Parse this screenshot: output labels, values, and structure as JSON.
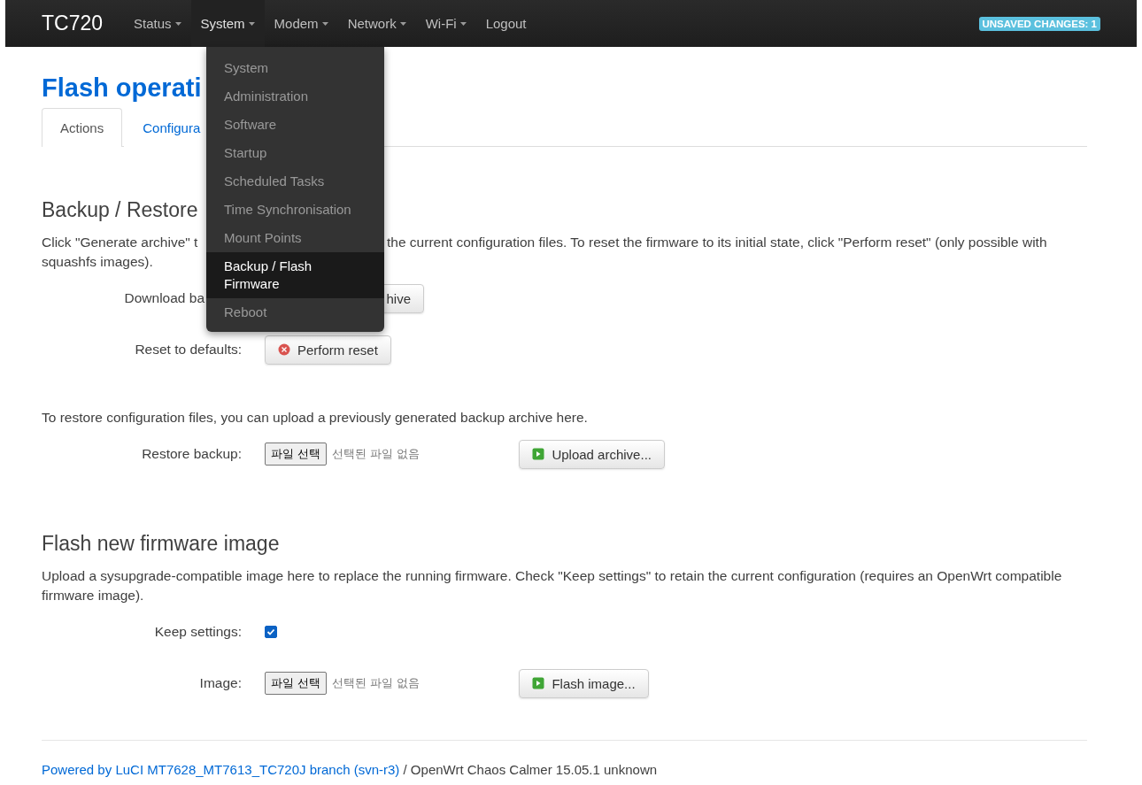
{
  "navbar": {
    "brand": "TC720",
    "items": [
      {
        "label": "Status",
        "caret": true,
        "selected": false
      },
      {
        "label": "System",
        "caret": true,
        "selected": true
      },
      {
        "label": "Modem",
        "caret": true,
        "selected": false
      },
      {
        "label": "Network",
        "caret": true,
        "selected": false
      },
      {
        "label": "Wi-Fi",
        "caret": true,
        "selected": false
      },
      {
        "label": "Logout",
        "caret": false,
        "selected": false
      }
    ],
    "badge": "UNSAVED CHANGES: 1"
  },
  "dropdown": {
    "items": [
      {
        "label": "System",
        "selected": false
      },
      {
        "label": "Administration",
        "selected": false
      },
      {
        "label": "Software",
        "selected": false
      },
      {
        "label": "Startup",
        "selected": false
      },
      {
        "label": "Scheduled Tasks",
        "selected": false
      },
      {
        "label": "Time Synchronisation",
        "selected": false
      },
      {
        "label": "Mount Points",
        "selected": false
      },
      {
        "label": "Backup / Flash Firmware",
        "selected": true
      },
      {
        "label": "Reboot",
        "selected": false
      }
    ]
  },
  "title": "Flash operati",
  "tabs": [
    {
      "label": "Actions",
      "selected": true
    },
    {
      "label": "Configura",
      "selected": false
    }
  ],
  "backup": {
    "heading": "Backup / Restore",
    "text_start": "Click \"Generate archive\" t",
    "text_end": "the current configuration files. To reset the firmware to its initial state, click \"Perform reset\" (only possible with",
    "text_end_2": "squashfs images).",
    "download_label": "Download ba",
    "download_button": "hive",
    "reset_label": "Reset to defaults:",
    "reset_button": "Perform reset",
    "restore_text": "To restore configuration files, you can upload a previously generated backup archive here.",
    "restore_label": "Restore backup:",
    "file_button": "파일 선택",
    "file_status": "선택된 파일 없음",
    "upload_button": "Upload archive..."
  },
  "flash": {
    "heading": "Flash new firmware image",
    "text": "Upload a sysupgrade-compatible image here to replace the running firmware. Check \"Keep settings\" to retain the current configuration (requires an OpenWrt compatible firmware image).",
    "keep_label": "Keep settings:",
    "keep_checked": true,
    "image_label": "Image:",
    "file_button": "파일 선택",
    "file_status": "선택된 파일 없음",
    "flash_button": "Flash image..."
  },
  "footer": {
    "link": "Powered by LuCI MT7628_MT7613_TC720J branch (svn-r3)",
    "text": "/ OpenWrt Chaos Calmer 15.05.1 unknown"
  }
}
